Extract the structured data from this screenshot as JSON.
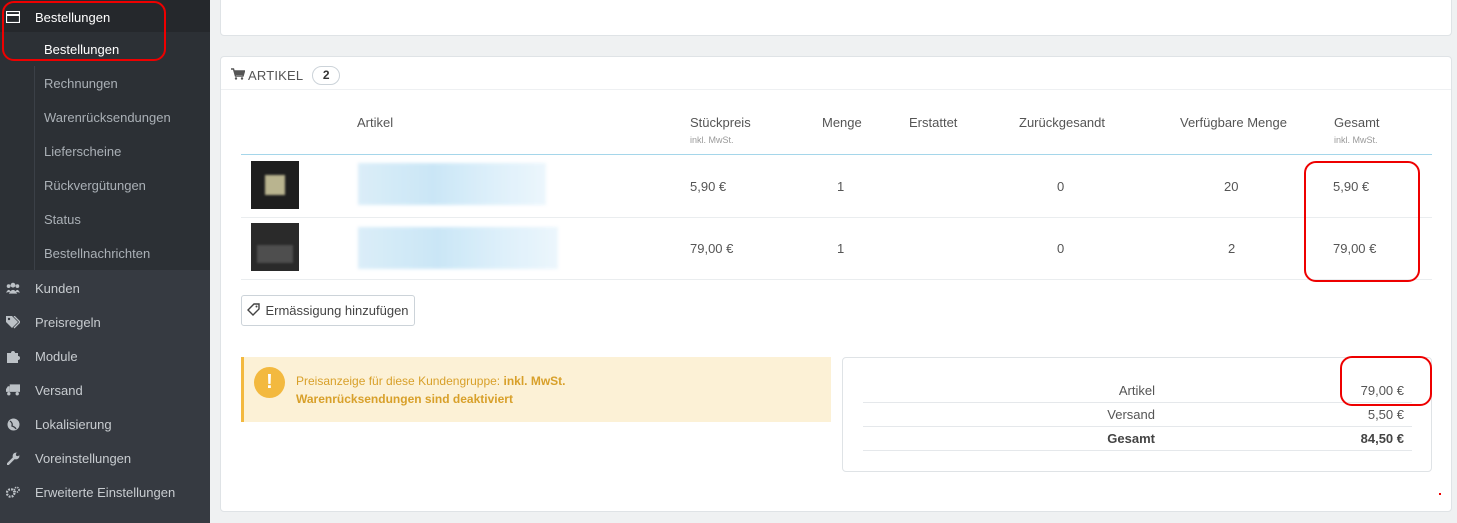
{
  "sidebar": {
    "orders_label": "Bestellungen",
    "sub_items": [
      {
        "label": "Bestellungen"
      },
      {
        "label": "Rechnungen"
      },
      {
        "label": "Warenrücksendungen"
      },
      {
        "label": "Lieferscheine"
      },
      {
        "label": "Rückvergütungen"
      },
      {
        "label": "Status"
      },
      {
        "label": "Bestellnachrichten"
      }
    ],
    "items": [
      {
        "label": "Kunden",
        "icon": "users-icon"
      },
      {
        "label": "Preisregeln",
        "icon": "tags-icon"
      },
      {
        "label": "Module",
        "icon": "puzzle-icon"
      },
      {
        "label": "Versand",
        "icon": "truck-icon"
      },
      {
        "label": "Lokalisierung",
        "icon": "globe-icon"
      },
      {
        "label": "Voreinstellungen",
        "icon": "wrench-icon"
      },
      {
        "label": "Erweiterte Einstellungen",
        "icon": "cogs-icon"
      }
    ]
  },
  "articles_panel": {
    "title": "ARTIKEL",
    "count": "2",
    "columns": {
      "article": "Artikel",
      "unit_price": "Stückpreis",
      "unit_price_sub": "inkl. MwSt.",
      "quantity": "Menge",
      "refunded": "Erstattet",
      "returned": "Zurückgesandt",
      "available": "Verfügbare Menge",
      "total": "Gesamt",
      "total_sub": "inkl. MwSt."
    },
    "rows": [
      {
        "unit_price": "5,90 €",
        "quantity": "1",
        "returned": "0",
        "available": "20",
        "total": "5,90 €"
      },
      {
        "unit_price": "79,00 €",
        "quantity": "1",
        "returned": "0",
        "available": "2",
        "total": "79,00 €"
      }
    ],
    "discount_button": "Ermässigung hinzufügen",
    "alert": {
      "line1_prefix": "Preisanzeige für diese Kundengruppe: ",
      "line1_bold": "inkl. MwSt.",
      "line2": "Warenrücksendungen sind deaktiviert"
    },
    "totals": [
      {
        "label": "Artikel",
        "value": "79,00 €"
      },
      {
        "label": "Versand",
        "value": "5,50 €"
      },
      {
        "label": "Gesamt",
        "value": "84,50 €"
      }
    ]
  },
  "colors": {
    "sidebar_bg": "#363a41",
    "annotation": "#e00000",
    "alert_bg": "#fcf1d6",
    "alert_accent": "#f3b93f"
  }
}
